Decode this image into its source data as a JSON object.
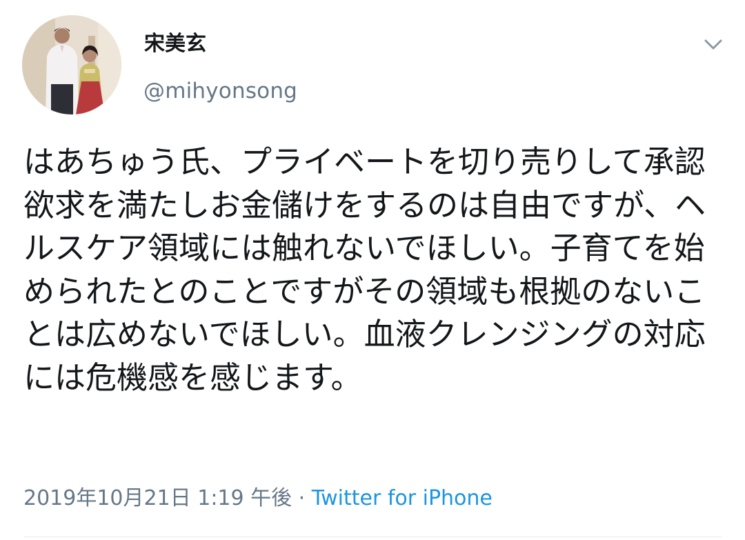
{
  "tweet": {
    "author": {
      "display_name": "宋美玄",
      "handle": "@mihyonsong"
    },
    "text": "はあちゅう氏、プライベートを切り売りして承認欲求を満たしお金儲けをするのは自由ですが、ヘルスケア領域には触れないでほしい。子育てを始められたとのことですがその領域も根拠のないことは広めないでほしい。血液クレンジングの対応には危機感を感じます。",
    "timestamp": "2019年10月21日 1:19 午後",
    "separator": " · ",
    "source": "Twitter for iPhone",
    "menu_icon": "chevron-down-icon"
  },
  "colors": {
    "text": "#14171a",
    "secondary": "#657786",
    "link": "#1b95e0",
    "divider": "#e6ecf0"
  }
}
